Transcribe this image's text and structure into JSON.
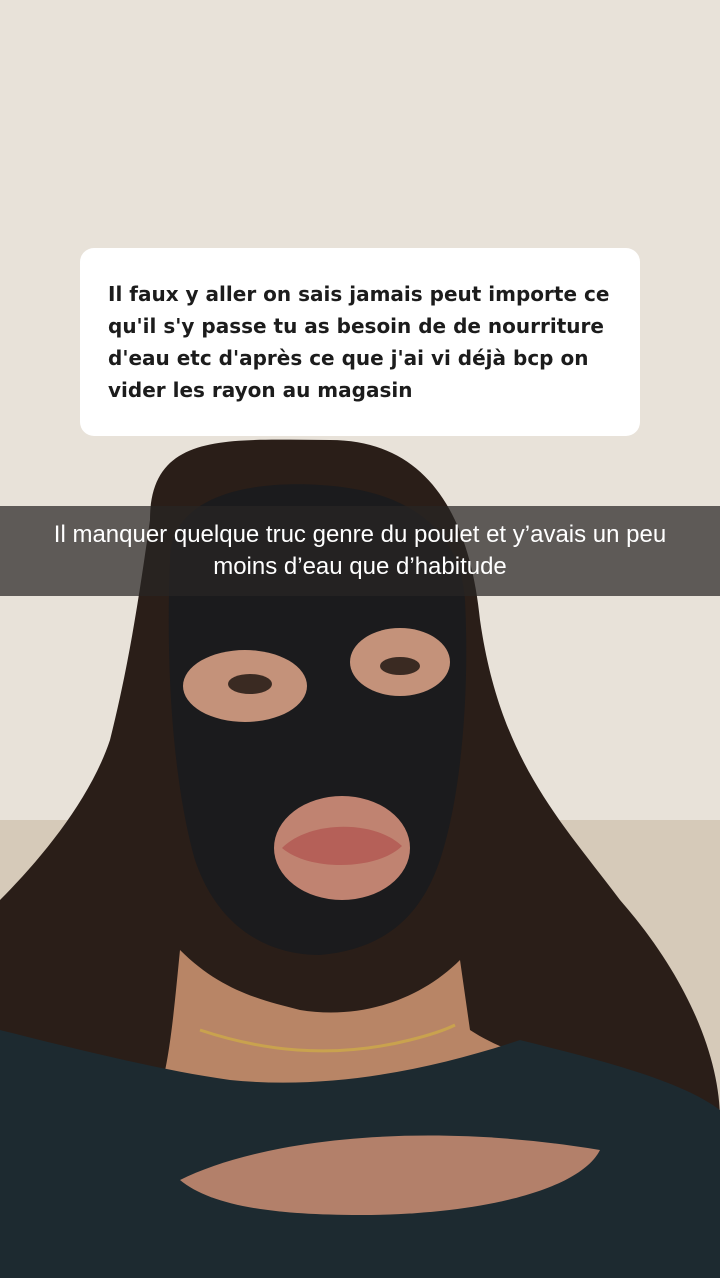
{
  "story": {
    "question_sticker": {
      "text": "Il faux y aller on sais jamais peut importe ce qu'il s'y passe tu as besoin de de nourriture d'eau etc d'après ce que j'ai vi déjà bcp on vider les rayon au magasin"
    },
    "caption": {
      "text": "Il manquer quelque truc genre du poulet et y’avais un peu moins d’eau que d’habitude"
    },
    "photo": {
      "subject": "person-wearing-black-knit-balaclava"
    }
  }
}
